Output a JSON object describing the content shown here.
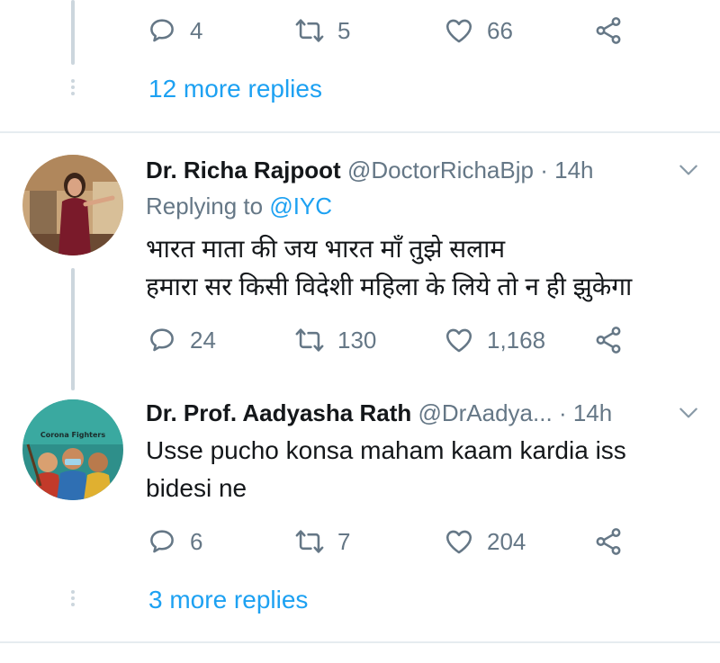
{
  "top_tweet": {
    "actions": {
      "replies": "4",
      "retweets": "5",
      "likes": "66"
    },
    "more_replies": "12 more replies"
  },
  "tweet1": {
    "name": "Dr. Richa Rajpoot",
    "handle": "@DoctorRichaBjp",
    "separator": "·",
    "time": "14h",
    "replying_prefix": "Replying to",
    "replying_handle": "@IYC",
    "text_line1": "भारत माता की जय भारत माँ तुझे सलाम",
    "text_line2": "हमारा सर किसी विदेशी महिला के लिये तो न ही झुकेगा",
    "actions": {
      "replies": "24",
      "retweets": "130",
      "likes": "1,168"
    }
  },
  "tweet2": {
    "name": "Dr. Prof. Aadyasha Rath",
    "handle": "@DrAadya...",
    "separator": "·",
    "time": "14h",
    "avatar_caption": "Corona Fighters",
    "text_line1": "Usse pucho konsa maham kaam kardia iss",
    "text_line2": "bidesi ne",
    "actions": {
      "replies": "6",
      "retweets": "7",
      "likes": "204"
    },
    "more_replies": "3 more replies"
  },
  "colors": {
    "accent": "#1da1f2",
    "muted": "#657786",
    "thread": "#ccd6dd"
  },
  "icons": [
    "reply-icon",
    "retweet-icon",
    "like-icon",
    "share-icon",
    "chevron-down-icon"
  ]
}
